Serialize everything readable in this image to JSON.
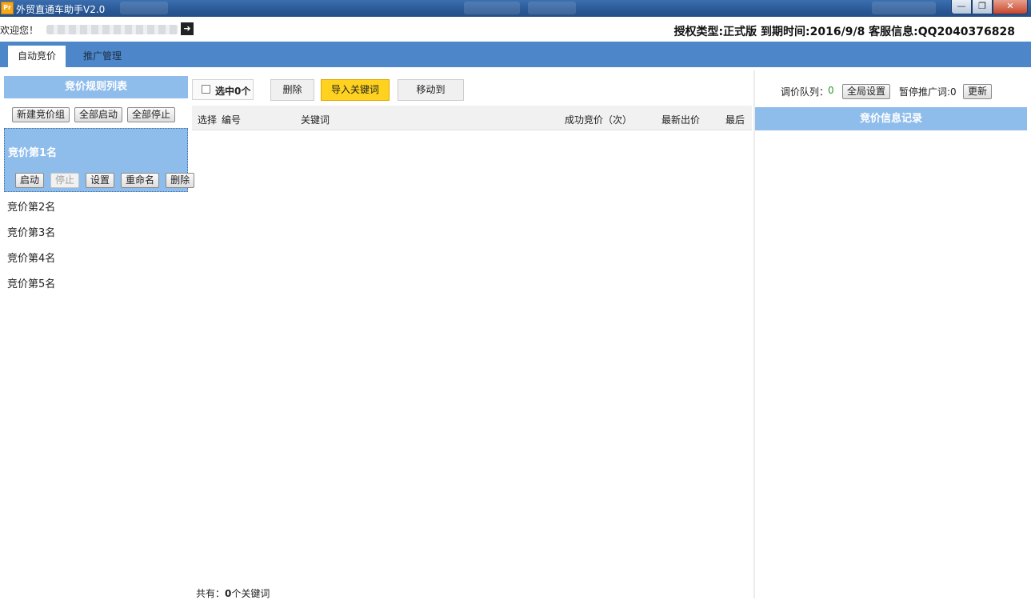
{
  "window": {
    "title": "外贸直通车助手V2.0",
    "icon": "app-logo-icon",
    "buttons": [
      "minimize-icon",
      "maximize-icon",
      "close-icon"
    ]
  },
  "header": {
    "welcome": "欢迎您！",
    "license": "授权类型:正式版 到期时间:2016/9/8 客服信息:QQ2040376828"
  },
  "tabs": [
    {
      "label": "自动竞价",
      "active": true
    },
    {
      "label": "推广管理",
      "active": false
    }
  ],
  "left": {
    "title": "竞价规则列表",
    "buttons": [
      "新建竞价组",
      "全部启动",
      "全部停止"
    ],
    "selected_group": {
      "name": "竞价第1名",
      "buttons": [
        "启动",
        "停止",
        "设置",
        "重命名",
        "删除"
      ]
    },
    "groups": [
      "竞价第2名",
      "竞价第3名",
      "竞价第4名",
      "竞价第5名"
    ]
  },
  "center": {
    "select_label": "选中0个",
    "buttons": {
      "delete": "删除",
      "import": "导入关键词",
      "move": "移动到"
    },
    "columns": [
      "选择",
      "编号",
      "关键词",
      "成功竞价（次）",
      "最新出价",
      "最后"
    ],
    "footer_prefix": "共有：",
    "footer_count": "0",
    "footer_suffix": "个关键词"
  },
  "right": {
    "queue_label": "调价队列：",
    "queue_value": "0",
    "global_settings": "全局设置",
    "paused_label": "暂停推广词:0",
    "refresh": "更新",
    "info_title": "竞价信息记录"
  },
  "colors": {
    "accent_blue": "#4d86c9",
    "panel_blue": "#8ebceb",
    "import_yellow": "#ffd21f",
    "queue_green": "#2a9d2a"
  }
}
